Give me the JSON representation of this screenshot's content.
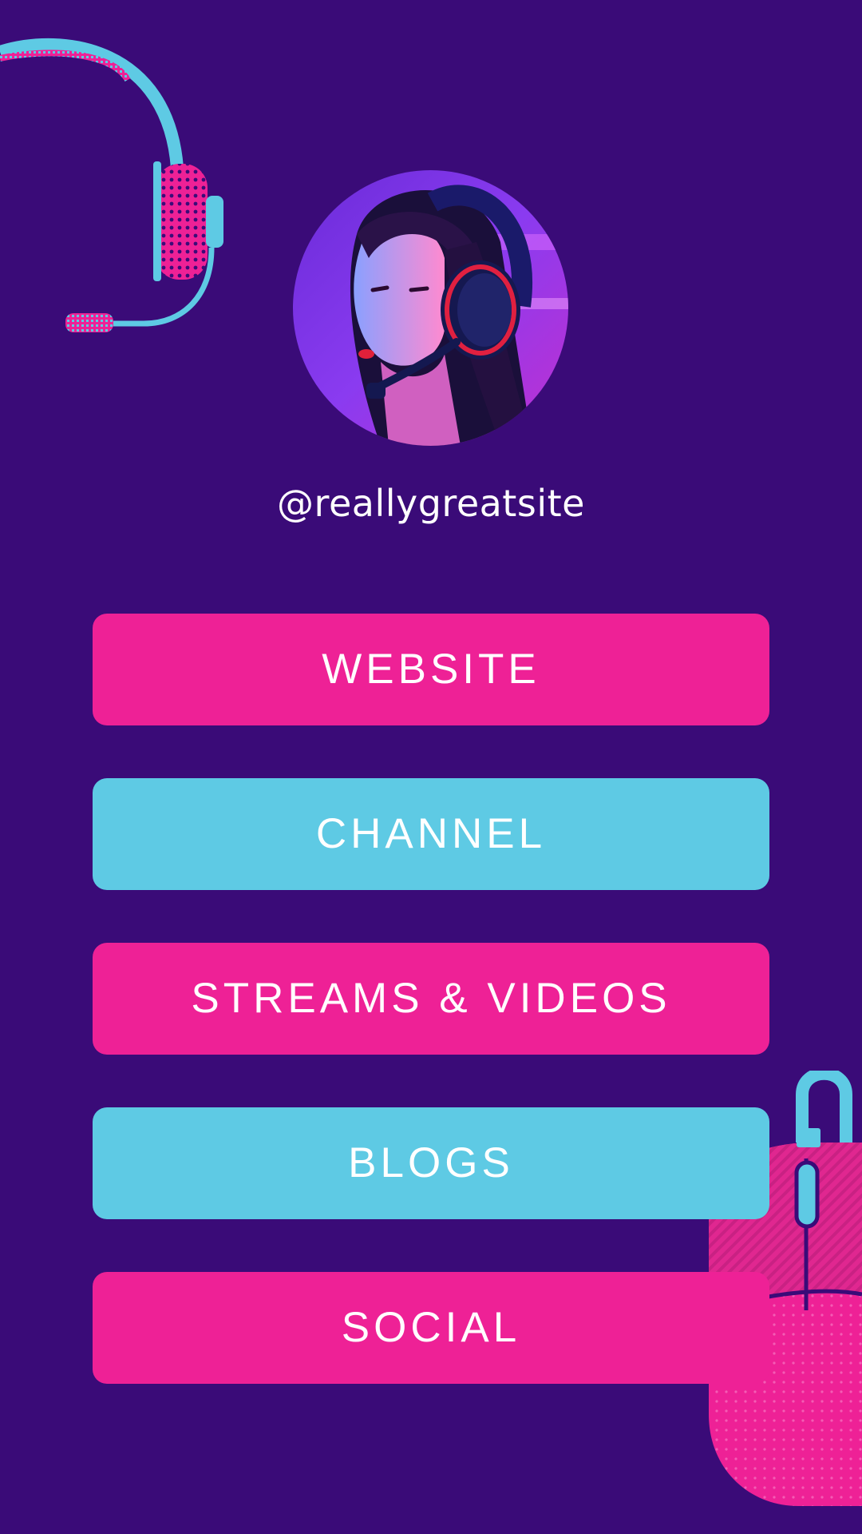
{
  "profile": {
    "handle": "@reallygreatsite",
    "avatar_icon": "gamer-avatar-photo"
  },
  "decorations": {
    "top_left": "headset-icon",
    "bottom_right": "mouse-icon"
  },
  "colors": {
    "background": "#3a0b78",
    "pink": "#ee2196",
    "blue": "#5ecae4",
    "text": "#ffffff"
  },
  "links": [
    {
      "label": "WEBSITE",
      "color": "pink"
    },
    {
      "label": "CHANNEL",
      "color": "blue"
    },
    {
      "label": "STREAMS & VIDEOS",
      "color": "pink"
    },
    {
      "label": "BLOGS",
      "color": "blue"
    },
    {
      "label": "SOCIAL",
      "color": "pink"
    }
  ]
}
